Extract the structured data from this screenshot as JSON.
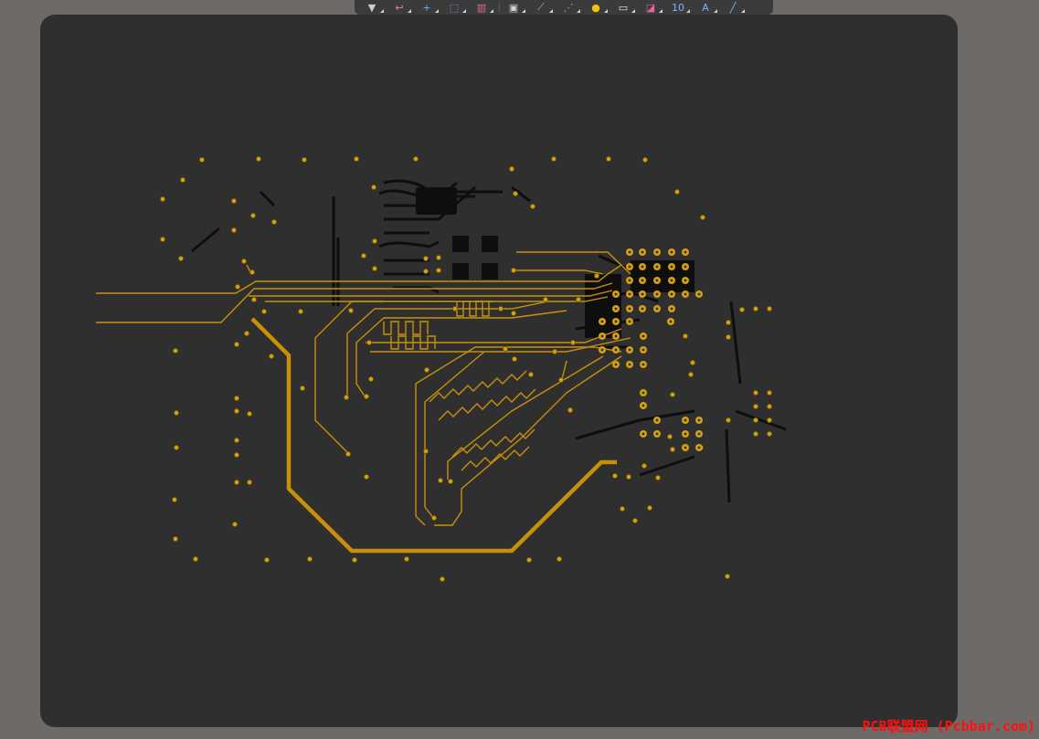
{
  "toolbar": {
    "items": [
      {
        "name": "filter-icon",
        "glyph": "▼",
        "color": "#c8d0dc"
      },
      {
        "name": "route-icon",
        "glyph": "↩",
        "color": "#e58a8a"
      },
      {
        "name": "add-icon",
        "glyph": "+",
        "color": "#6aa8ff"
      },
      {
        "name": "select-rect-icon",
        "glyph": "⬚",
        "color": "#6aa8ff"
      },
      {
        "name": "align-icon",
        "glyph": "▥",
        "color": "#d86aa0"
      },
      {
        "name": "component-icon",
        "glyph": "▣",
        "color": "#d0d0d0"
      },
      {
        "name": "interactive-route-icon",
        "glyph": "⟋",
        "color": "#d6b25a"
      },
      {
        "name": "diff-pair-icon",
        "glyph": "⋰",
        "color": "#7fb0ff"
      },
      {
        "name": "via-icon",
        "glyph": "●",
        "color": "#f1c40f"
      },
      {
        "name": "fill-icon",
        "glyph": "▭",
        "color": "#d8e6ff"
      },
      {
        "name": "polygon-icon",
        "glyph": "◪",
        "color": "#e06aa0"
      },
      {
        "name": "dimension-icon",
        "glyph": "10",
        "color": "#7fb0ff"
      },
      {
        "name": "text-icon",
        "glyph": "A",
        "color": "#7fb0ff"
      },
      {
        "name": "line-icon",
        "glyph": "╱",
        "color": "#7fb0ff"
      }
    ]
  },
  "colors": {
    "board": "#2f2f2f",
    "trace": "#c8900a",
    "pad": "#d4a017",
    "pad_hole": "#3a3000",
    "dark_layer": "#0e0e0e"
  },
  "watermark": "PCB联盟网 (Pcbbar.com)"
}
